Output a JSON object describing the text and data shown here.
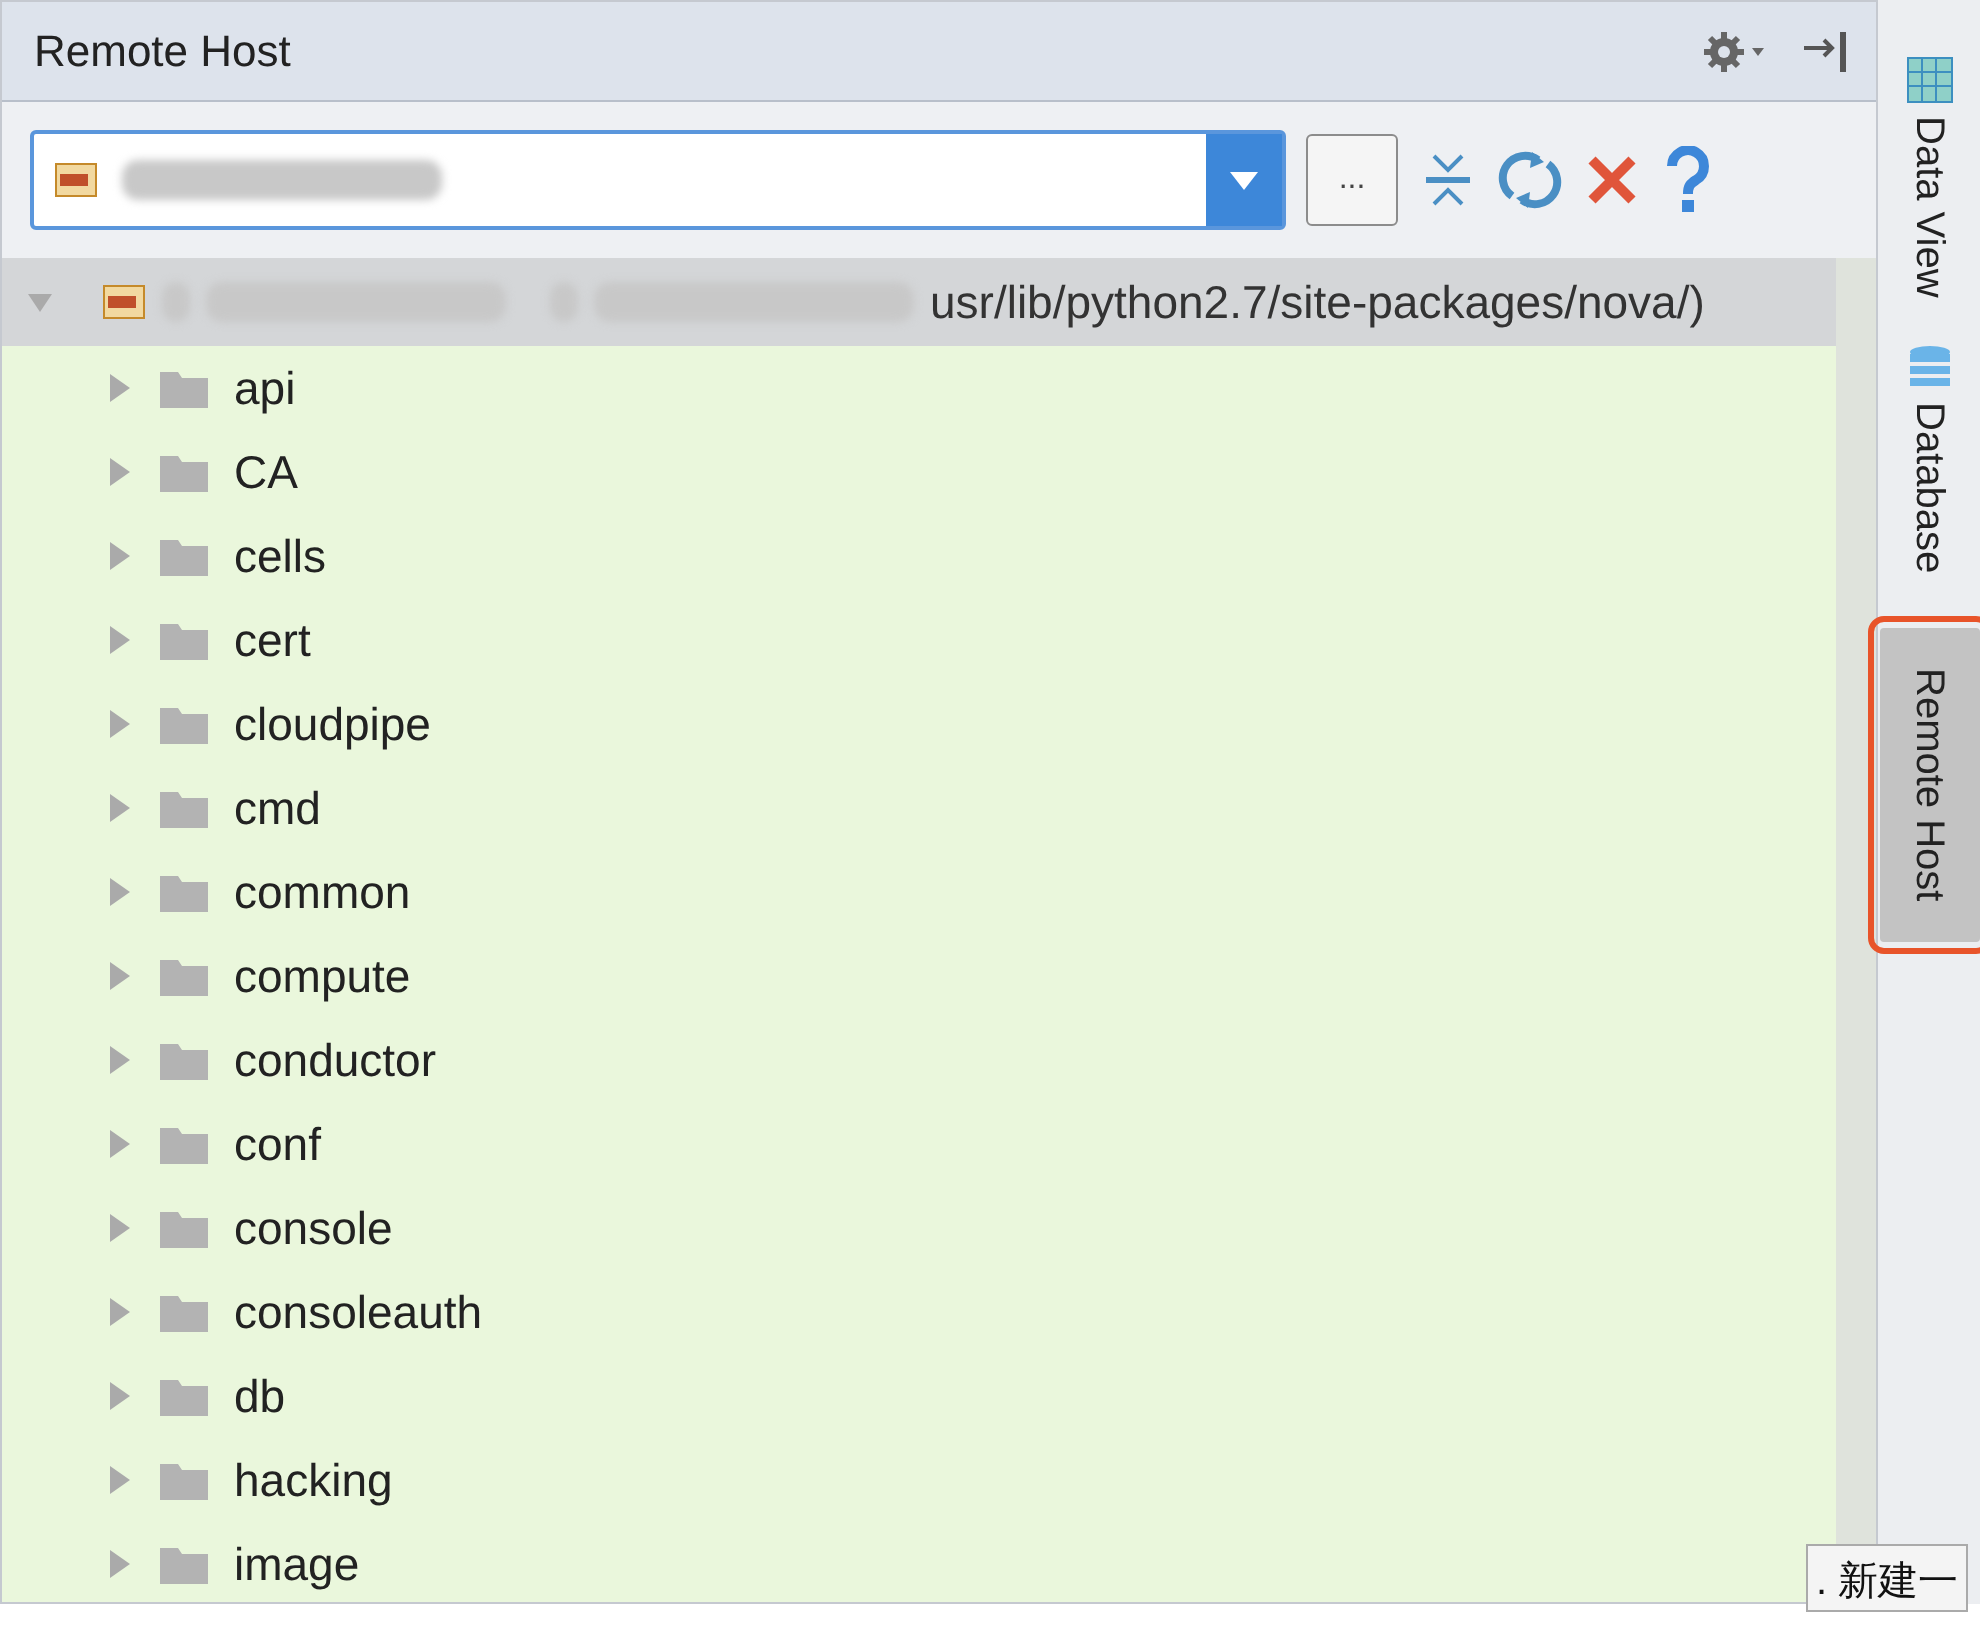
{
  "panel": {
    "title": "Remote Host"
  },
  "toolbar": {
    "host_field": {
      "value_redacted": true
    },
    "browse_button": "..."
  },
  "tree": {
    "root": {
      "label": "usr/lib/python2.7/site-packages/nova/)",
      "expanded": true,
      "selected": true,
      "children": [
        {
          "label": "api",
          "expanded": false
        },
        {
          "label": "CA",
          "expanded": false
        },
        {
          "label": "cells",
          "expanded": false
        },
        {
          "label": "cert",
          "expanded": false
        },
        {
          "label": "cloudpipe",
          "expanded": false
        },
        {
          "label": "cmd",
          "expanded": false
        },
        {
          "label": "common",
          "expanded": false
        },
        {
          "label": "compute",
          "expanded": false
        },
        {
          "label": "conductor",
          "expanded": false
        },
        {
          "label": "conf",
          "expanded": false
        },
        {
          "label": "console",
          "expanded": false
        },
        {
          "label": "consoleauth",
          "expanded": false
        },
        {
          "label": "db",
          "expanded": false
        },
        {
          "label": "hacking",
          "expanded": false
        },
        {
          "label": "image",
          "expanded": false
        }
      ]
    }
  },
  "side_tabs": [
    {
      "label": "Data View",
      "kind": "table",
      "selected": false
    },
    {
      "label": "Database",
      "kind": "database",
      "selected": false
    },
    {
      "label": "Remote Host",
      "kind": "none",
      "selected": true
    }
  ],
  "popup": {
    "text": ". 新建一"
  }
}
